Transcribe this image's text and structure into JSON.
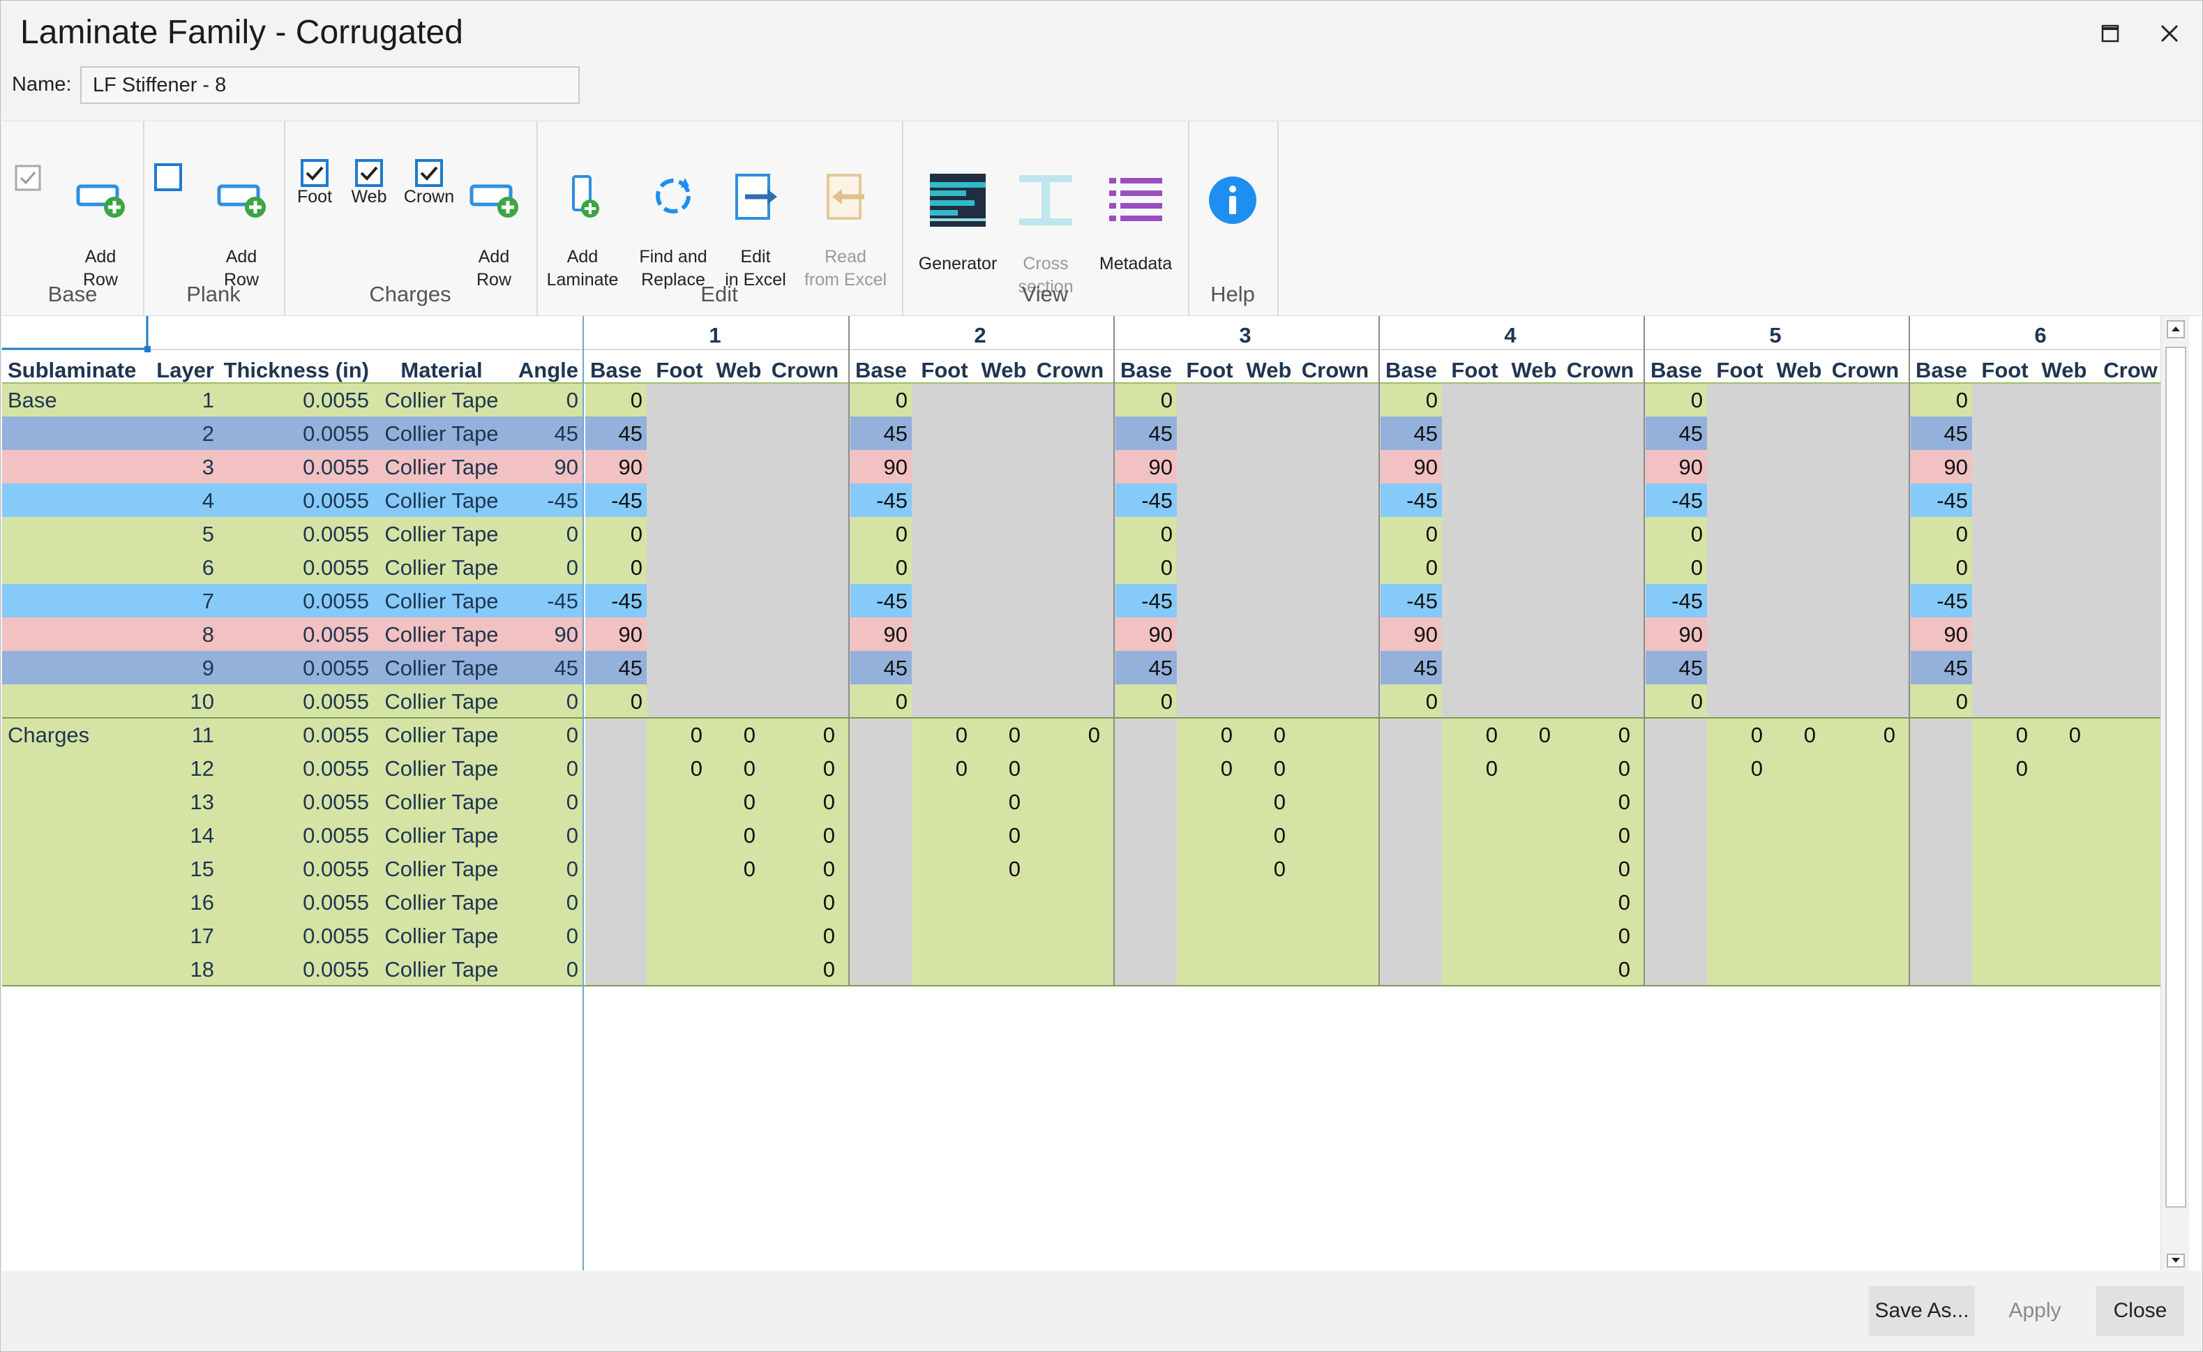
{
  "window": {
    "title": "Laminate Family - Corrugated"
  },
  "name_field": {
    "label": "Name:",
    "value": "LF Stiffener - 8"
  },
  "ribbon": {
    "groups": [
      {
        "label": "Base"
      },
      {
        "label": "Plank"
      },
      {
        "label": "Charges"
      },
      {
        "label": "Edit"
      },
      {
        "label": "View"
      },
      {
        "label": "Help"
      }
    ],
    "base_add_row": "Add\nRow",
    "plank_add_row": "Add\nRow",
    "charges_foot": "Foot",
    "charges_web": "Web",
    "charges_crown": "Crown",
    "charges_add_row": "Add\nRow",
    "add_laminate": "Add\nLaminate",
    "find_replace": "Find and\nReplace",
    "edit_excel": "Edit\nin Excel",
    "read_excel": "Read\nfrom Excel",
    "generator": "Generator",
    "cross_section": "Cross\nsection",
    "metadata": "Metadata"
  },
  "colors": {
    "zero": "#d5e4a4",
    "p45": "#93b1db",
    "n45": "#86cafa",
    "p90": "#f2c1c1",
    "gray": "#d3d3d3",
    "accent": "#1e8ff0"
  },
  "table": {
    "columns": [
      "Sublaminate",
      "Layer",
      "Thickness (in)",
      "Material",
      "Angle"
    ],
    "sub_columns": [
      "Base",
      "Foot",
      "Web",
      "Crown"
    ],
    "laminates": [
      "1",
      "2",
      "3",
      "4",
      "5",
      "6"
    ],
    "last_sub_truncated": "Crow",
    "rows": [
      {
        "sub": "Base",
        "layer": "1",
        "thk": "0.0055",
        "mat": "Collier Tape",
        "angle": "0"
      },
      {
        "sub": "",
        "layer": "2",
        "thk": "0.0055",
        "mat": "Collier Tape",
        "angle": "45"
      },
      {
        "sub": "",
        "layer": "3",
        "thk": "0.0055",
        "mat": "Collier Tape",
        "angle": "90"
      },
      {
        "sub": "",
        "layer": "4",
        "thk": "0.0055",
        "mat": "Collier Tape",
        "angle": "-45"
      },
      {
        "sub": "",
        "layer": "5",
        "thk": "0.0055",
        "mat": "Collier Tape",
        "angle": "0"
      },
      {
        "sub": "",
        "layer": "6",
        "thk": "0.0055",
        "mat": "Collier Tape",
        "angle": "0"
      },
      {
        "sub": "",
        "layer": "7",
        "thk": "0.0055",
        "mat": "Collier Tape",
        "angle": "-45"
      },
      {
        "sub": "",
        "layer": "8",
        "thk": "0.0055",
        "mat": "Collier Tape",
        "angle": "90"
      },
      {
        "sub": "",
        "layer": "9",
        "thk": "0.0055",
        "mat": "Collier Tape",
        "angle": "45"
      },
      {
        "sub": "",
        "layer": "10",
        "thk": "0.0055",
        "mat": "Collier Tape",
        "angle": "0"
      },
      {
        "sub": "Charges",
        "layer": "11",
        "thk": "0.0055",
        "mat": "Collier Tape",
        "angle": "0"
      },
      {
        "sub": "",
        "layer": "12",
        "thk": "0.0055",
        "mat": "Collier Tape",
        "angle": "0"
      },
      {
        "sub": "",
        "layer": "13",
        "thk": "0.0055",
        "mat": "Collier Tape",
        "angle": "0"
      },
      {
        "sub": "",
        "layer": "14",
        "thk": "0.0055",
        "mat": "Collier Tape",
        "angle": "0"
      },
      {
        "sub": "",
        "layer": "15",
        "thk": "0.0055",
        "mat": "Collier Tape",
        "angle": "0"
      },
      {
        "sub": "",
        "layer": "16",
        "thk": "0.0055",
        "mat": "Collier Tape",
        "angle": "0"
      },
      {
        "sub": "",
        "layer": "17",
        "thk": "0.0055",
        "mat": "Collier Tape",
        "angle": "0"
      },
      {
        "sub": "",
        "layer": "18",
        "thk": "0.0055",
        "mat": "Collier Tape",
        "angle": "0"
      }
    ],
    "charges_cells": [
      [
        [
          "0",
          "0",
          "0"
        ],
        [
          "0",
          "0",
          "0"
        ],
        [
          "0",
          "0",
          ""
        ],
        [
          "0",
          "0",
          "0"
        ],
        [
          "0",
          "0",
          "0"
        ],
        [
          "0",
          "0",
          ""
        ]
      ],
      [
        [
          "0",
          "0",
          "0"
        ],
        [
          "0",
          "0",
          ""
        ],
        [
          "0",
          "0",
          ""
        ],
        [
          "0",
          "",
          "0"
        ],
        [
          "0",
          "",
          ""
        ],
        [
          "0",
          "",
          ""
        ]
      ],
      [
        [
          "",
          "0",
          "0"
        ],
        [
          "",
          "0",
          ""
        ],
        [
          "",
          "0",
          ""
        ],
        [
          "",
          "",
          "0"
        ],
        [
          "",
          "",
          ""
        ],
        [
          "",
          "",
          ""
        ]
      ],
      [
        [
          "",
          "0",
          "0"
        ],
        [
          "",
          "0",
          ""
        ],
        [
          "",
          "0",
          ""
        ],
        [
          "",
          "",
          "0"
        ],
        [
          "",
          "",
          ""
        ],
        [
          "",
          "",
          ""
        ]
      ],
      [
        [
          "",
          "0",
          "0"
        ],
        [
          "",
          "0",
          ""
        ],
        [
          "",
          "0",
          ""
        ],
        [
          "",
          "",
          "0"
        ],
        [
          "",
          "",
          ""
        ],
        [
          "",
          "",
          ""
        ]
      ],
      [
        [
          "",
          "",
          "0"
        ],
        [
          "",
          "",
          ""
        ],
        [
          "",
          "",
          ""
        ],
        [
          "",
          "",
          "0"
        ],
        [
          "",
          "",
          ""
        ],
        [
          "",
          "",
          ""
        ]
      ],
      [
        [
          "",
          "",
          "0"
        ],
        [
          "",
          "",
          ""
        ],
        [
          "",
          "",
          ""
        ],
        [
          "",
          "",
          "0"
        ],
        [
          "",
          "",
          ""
        ],
        [
          "",
          "",
          ""
        ]
      ],
      [
        [
          "",
          "",
          "0"
        ],
        [
          "",
          "",
          ""
        ],
        [
          "",
          "",
          ""
        ],
        [
          "",
          "",
          "0"
        ],
        [
          "",
          "",
          ""
        ],
        [
          "",
          "",
          ""
        ]
      ]
    ]
  },
  "footer": {
    "save_as": "Save As...",
    "apply": "Apply",
    "close": "Close"
  }
}
